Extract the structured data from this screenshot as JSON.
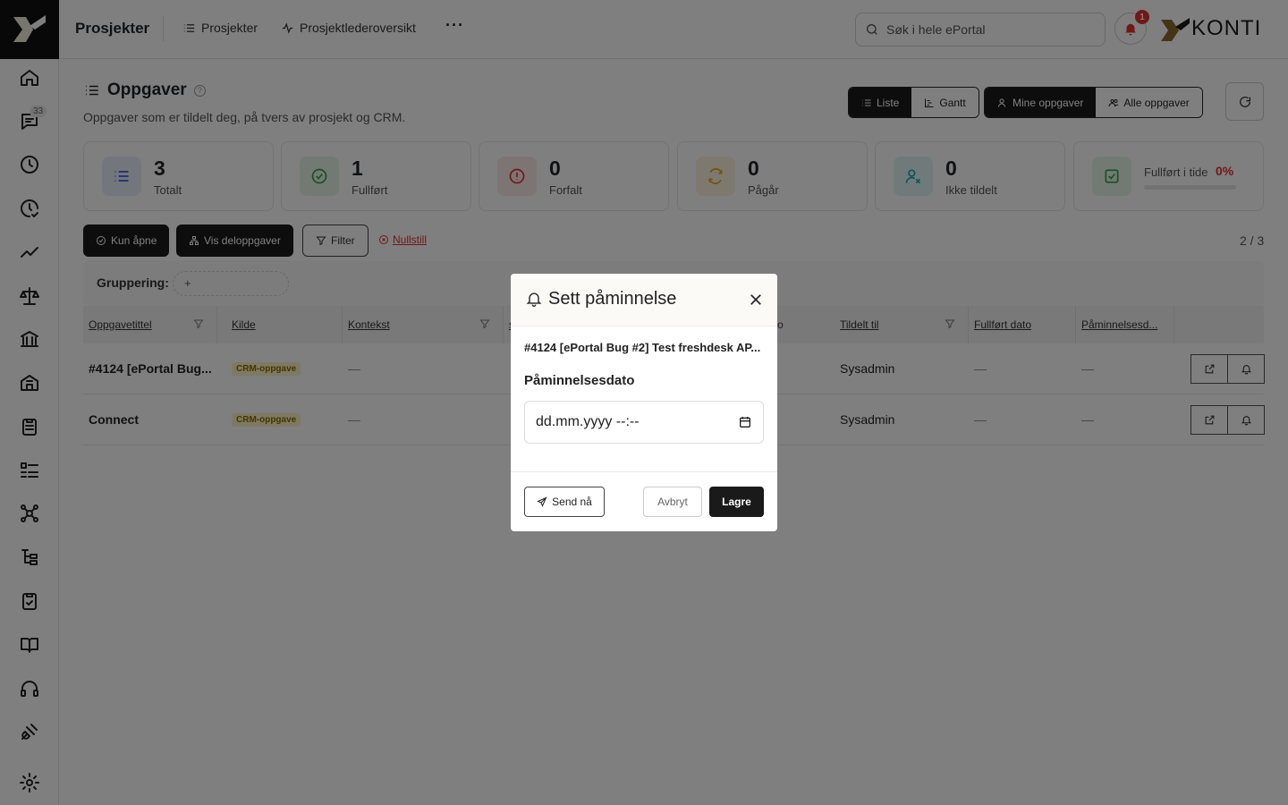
{
  "app": {
    "section_title": "Prosjekter",
    "nav": [
      "Prosjekter",
      "Prosjektlederoversikt"
    ],
    "more_label": "···",
    "search_placeholder": "Søk i hele ePortal",
    "notification_count": "1",
    "brand": "KONTI"
  },
  "sidebar": {
    "items": [
      {
        "icon": "home-icon"
      },
      {
        "icon": "chat-icon",
        "badge": "33"
      },
      {
        "icon": "clock-icon"
      },
      {
        "icon": "clock-check-icon"
      },
      {
        "icon": "trend-icon"
      },
      {
        "icon": "scale-icon"
      },
      {
        "icon": "bank-icon"
      },
      {
        "icon": "building-icon"
      },
      {
        "icon": "clipboard-icon"
      },
      {
        "icon": "list-icon"
      },
      {
        "icon": "network-icon"
      },
      {
        "icon": "tree-icon"
      },
      {
        "icon": "clipboard-check-icon"
      },
      {
        "icon": "book-icon"
      },
      {
        "icon": "headset-icon"
      },
      {
        "icon": "plug-icon"
      },
      {
        "icon": "gear-icon"
      }
    ]
  },
  "page": {
    "title": "Oppgaver",
    "help": "?",
    "subtitle": "Oppgaver som er tildelt deg, på tvers av prosjekt og CRM.",
    "view_toggle": [
      "Liste",
      "Gantt"
    ],
    "scope_toggle": [
      "Mine oppgaver",
      "Alle oppgaver"
    ]
  },
  "stats": [
    {
      "value": "3",
      "label": "Totalt",
      "color": "#3b5bdb"
    },
    {
      "value": "1",
      "label": "Fullført",
      "color": "#2f9e44"
    },
    {
      "value": "0",
      "label": "Forfalt",
      "color": "#e03131"
    },
    {
      "value": "0",
      "label": "Pågår",
      "color": "#e8a317"
    },
    {
      "value": "0",
      "label": "Ikke tildelt",
      "color": "#15aabf"
    },
    {
      "label": "Fullført i tide",
      "percent": "0%",
      "color": "#2f9e44"
    }
  ],
  "filters": {
    "only_open": "Kun åpne",
    "show_subtasks": "Vis deloppgaver",
    "filter": "Filter",
    "reset": "Nullstill",
    "count": "2 / 3"
  },
  "grouping": {
    "label": "Gruppering:",
    "add": "+"
  },
  "table": {
    "columns": [
      "Oppgavetittel",
      "Kilde",
      "Kontekst",
      "s",
      "ato",
      "Tildelt til",
      "Fullført dato",
      "Påminnelsesd..."
    ],
    "rows": [
      {
        "title": "#4124 [ePortal Bug...",
        "source": "CRM-oppgave",
        "context": "—",
        "assignee": "Sysadmin",
        "done_date": "—",
        "reminder": "—"
      },
      {
        "title": "Connect",
        "source": "CRM-oppgave",
        "context": "—",
        "assignee": "Sysadmin",
        "done_date": "—",
        "reminder": "—"
      }
    ]
  },
  "modal": {
    "title": "Sett påminnelse",
    "task": "#4124 [ePortal Bug #2] Test freshdesk AP...",
    "field_label": "Påminnelsesdato",
    "field_placeholder": "dd.mm.yyyy --:--",
    "send_now": "Send nå",
    "cancel": "Avbryt",
    "save": "Lagre"
  }
}
